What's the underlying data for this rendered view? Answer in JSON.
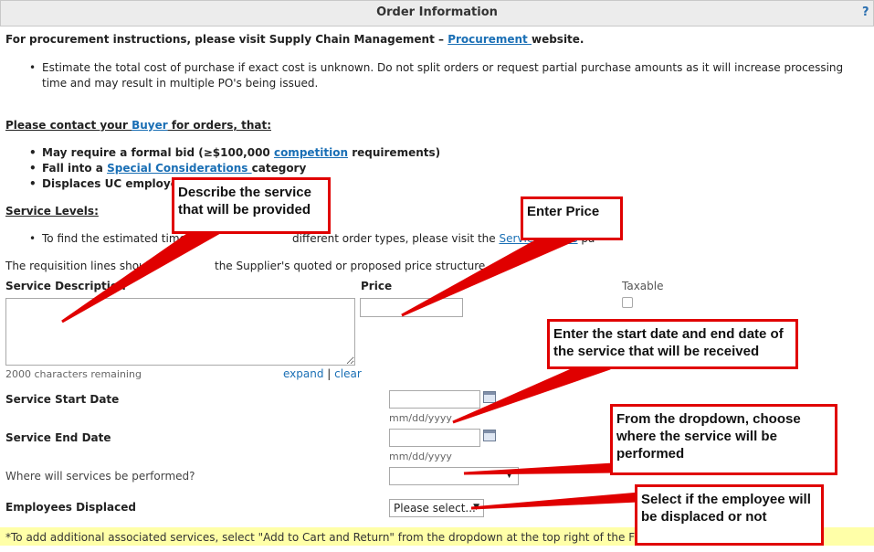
{
  "header": {
    "title": "Order Information",
    "help": "?"
  },
  "intro": {
    "prefix": "For procurement instructions, please visit Supply Chain Management – ",
    "link": "Procurement ",
    "suffix": "website."
  },
  "bullet1": "Estimate the total cost of purchase if exact cost is unknown. Do not split orders or request partial purchase amounts as it will increase processing time and may result in multiple PO's being issued.",
  "contact": {
    "prefix": "Please contact your ",
    "link": "Buyer",
    "suffix": " for orders, that:"
  },
  "contact_items": {
    "item1": {
      "prefix": "May require a formal bid (≥$100,000 ",
      "link": "competition",
      "suffix": " requirements)"
    },
    "item2": {
      "prefix": "Fall into a ",
      "link": "Special Considerations ",
      "suffix": "category"
    },
    "item3": {
      "text": "Displaces UC employee"
    }
  },
  "service_levels": {
    "heading": "Service Levels:",
    "bullet_prefix": "To find the estimated times",
    "bullet_mid": "different order types, please visit the ",
    "bullet_link": "Service Levels",
    "bullet_suffix": " pa"
  },
  "requisition_note": {
    "prefix": "The requisition lines should",
    "suffix": "the Supplier's quoted or proposed price structure."
  },
  "form": {
    "service_description_label": "Service Description",
    "price_label": "Price",
    "taxable_label": "Taxable",
    "chars_remaining": "2000 characters remaining",
    "expand": "expand",
    "separator": "|",
    "clear": "clear",
    "start_date_label": "Service Start Date",
    "end_date_label": "Service End Date",
    "date_format": "mm/dd/yyyy",
    "location_label": "Where will services be performed?",
    "employees_label": "Employees Displaced",
    "employees_value": "Please select..."
  },
  "footer": {
    "text": "*To add additional associated services, select \"Add to Cart and Return\" from the dropdown at the top right of the Form a"
  },
  "annotations": {
    "describe": "Describe the service that will be provided",
    "price": "Enter Price",
    "dates": "Enter the start date and end date of the service that will be received",
    "location": "From the dropdown, choose where the service will be performed",
    "employees": "Select if the employee will be displaced or not"
  },
  "colors": {
    "annotation": "#e00000",
    "link": "#1a6fb5",
    "footer_bg": "#ffffa8",
    "header_bg": "#ececec"
  }
}
